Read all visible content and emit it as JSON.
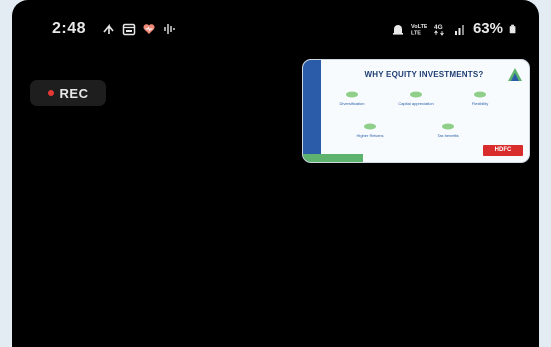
{
  "status_bar": {
    "time": "2:48",
    "left_icons": [
      "transfer-icon",
      "calendar-icon",
      "heart-icon",
      "voice-icon"
    ],
    "right_icons": [
      "alarm-icon",
      "volte-icon",
      "data-4g-icon",
      "signal-icon"
    ],
    "battery_percent": "63%"
  },
  "recording": {
    "label": "REC",
    "dot_color": "#e53935"
  },
  "pip_window": {
    "title": "WHY EQUITY INVESTMENTS?",
    "brand_label": "HDFC",
    "brand_color": "#d92c2c",
    "sidebar_color": "#2a5caa",
    "accent_color": "#5db36d",
    "items": [
      {
        "label": "Diversification",
        "sub": ""
      },
      {
        "label": "Capital appreciation",
        "sub": ""
      },
      {
        "label": "Flexibility",
        "sub": ""
      },
      {
        "label": "Higher Returns",
        "sub": ""
      },
      {
        "label": "Tax benefits",
        "sub": ""
      }
    ]
  }
}
